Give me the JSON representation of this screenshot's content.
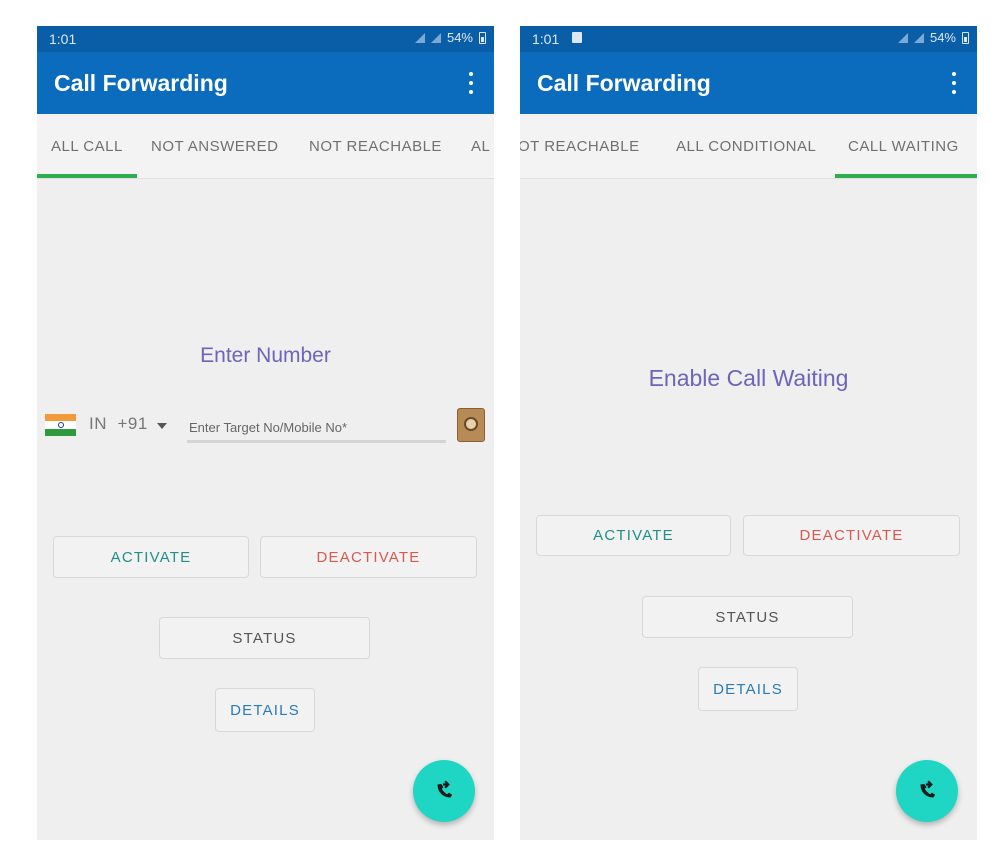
{
  "left_screen": {
    "status_bar": {
      "time": "1:01",
      "battery": "54%"
    },
    "app_bar": {
      "title": "Call Forwarding"
    },
    "tabs": [
      "ALL CALL",
      "NOT ANSWERED",
      "NOT REACHABLE",
      "AL"
    ],
    "heading": "Enter Number",
    "country": {
      "code": "IN",
      "dial": "+91"
    },
    "number_input": {
      "value": "",
      "placeholder": "Enter Target No/Mobile No*"
    },
    "buttons": {
      "activate": "ACTIVATE",
      "deactivate": "DEACTIVATE",
      "status": "STATUS",
      "details": "DETAILS"
    }
  },
  "right_screen": {
    "status_bar": {
      "time": "1:01",
      "battery": "54%"
    },
    "app_bar": {
      "title": "Call Forwarding"
    },
    "tabs": [
      "OT REACHABLE",
      "ALL CONDITIONAL",
      "CALL WAITING"
    ],
    "heading": "Enable Call Waiting",
    "buttons": {
      "activate": "ACTIVATE",
      "deactivate": "DEACTIVATE",
      "status": "STATUS",
      "details": "DETAILS"
    }
  },
  "icons": {
    "overflow": "more-vert-icon",
    "fab": "call-forward-icon",
    "contacts": "contact-book-icon",
    "flag": "india-flag-icon"
  },
  "colors": {
    "status_bar": "#0a5ea8",
    "app_bar": "#0b6bbd",
    "tab_indicator": "#2eae4f",
    "activate": "#1f8f87",
    "deactivate": "#d75a50",
    "details": "#2a7bb8",
    "fab": "#1ed6c3",
    "heading": "#6e64b8"
  }
}
